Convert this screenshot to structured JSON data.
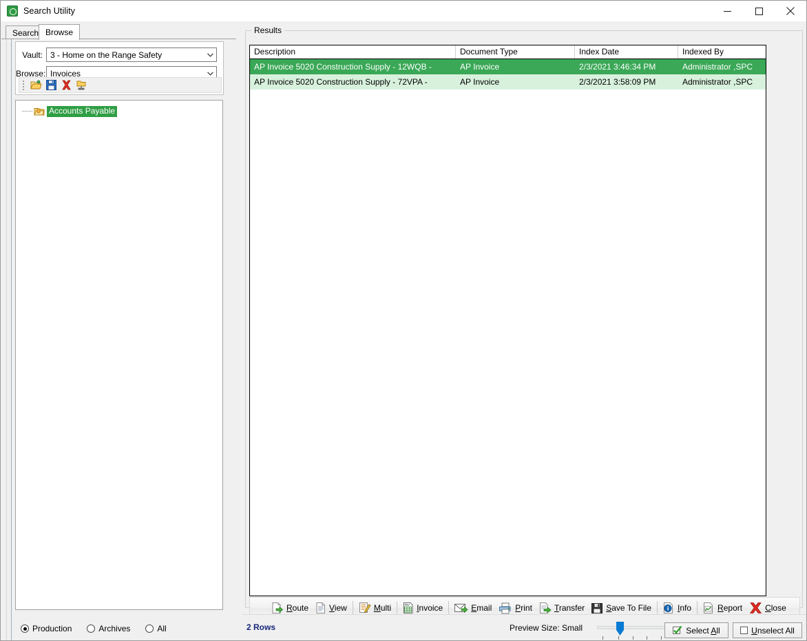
{
  "window": {
    "title": "Search Utility",
    "icon": "app-lock-icon",
    "minimize_label": "Minimize",
    "maximize_label": "Maximize",
    "close_label": "Close"
  },
  "tabs": [
    {
      "label": "Search",
      "active": false
    },
    {
      "label": "Browse",
      "active": true
    }
  ],
  "browse_panel": {
    "vault": {
      "label": "Vault:",
      "value": "3 - Home on the Range Safety"
    },
    "browse": {
      "label": "Browse:",
      "value": "Invoices"
    },
    "mini_toolbar": [
      {
        "name": "open-folder-icon",
        "tooltip": "Open"
      },
      {
        "name": "save-icon",
        "tooltip": "Save"
      },
      {
        "name": "delete-icon",
        "tooltip": "Delete"
      },
      {
        "name": "publish-folder-icon",
        "tooltip": "Publish"
      }
    ],
    "tree": {
      "nodes": [
        {
          "label": "Accounts Payable",
          "selected": true,
          "icon": "folder-icon"
        }
      ]
    },
    "scope_radios": [
      {
        "label": "Production",
        "checked": true
      },
      {
        "label": "Archives",
        "checked": false
      },
      {
        "label": "All",
        "checked": false
      }
    ]
  },
  "results": {
    "legend": "Results",
    "columns": [
      {
        "label": "Description"
      },
      {
        "label": "Document Type"
      },
      {
        "label": "Index Date"
      },
      {
        "label": "Indexed By"
      }
    ],
    "rows": [
      {
        "description": "AP Invoice 5020 Construction Supply - 12WQB -",
        "document_type": "AP Invoice",
        "index_date": "2/3/2021 3:46:34 PM",
        "indexed_by": "Administrator ,SPC",
        "selected": true
      },
      {
        "description": "AP Invoice 5020 Construction Supply - 72VPA -",
        "document_type": "AP Invoice",
        "index_date": "2/3/2021 3:58:09 PM",
        "indexed_by": "Administrator ,SPC",
        "selected": false
      }
    ]
  },
  "action_toolbar": [
    {
      "label": "Route",
      "accel": "R",
      "icon": "route-document-icon"
    },
    {
      "label": "View",
      "accel": "V",
      "icon": "view-document-icon"
    },
    {
      "label": "Multi",
      "accel": "M",
      "icon": "multi-edit-icon"
    },
    {
      "label": "Invoice",
      "accel": "I",
      "icon": "invoice-grid-icon"
    },
    {
      "label": "Email",
      "accel": "E",
      "icon": "email-envelope-icon"
    },
    {
      "label": "Print",
      "accel": "P",
      "icon": "printer-icon"
    },
    {
      "label": "Transfer",
      "accel": "T",
      "icon": "transfer-document-icon"
    },
    {
      "label": "Save To File",
      "accel": "S",
      "icon": "save-disk-icon"
    },
    {
      "label": "Info",
      "accel": "I",
      "icon": "info-circle-icon"
    },
    {
      "label": "Report",
      "accel": "R",
      "icon": "report-chart-icon"
    },
    {
      "label": "Close",
      "accel": "C",
      "icon": "close-x-icon"
    }
  ],
  "status_bar": {
    "rows_count": "2 Rows",
    "preview_size_label": "Preview Size: Small",
    "slider": {
      "value": 1,
      "min": 0,
      "max": 4,
      "ticks": 5
    },
    "select_all": {
      "label": "Select All",
      "accel": "A",
      "icon": "check-mark-icon"
    },
    "unselect_all": {
      "label": "Unselect All",
      "accel": "U",
      "icon": "empty-box-icon"
    }
  },
  "colors": {
    "selected_row": "#3aa856",
    "alt_row": "#d8f1dd",
    "tree_selection": "#2f9e44",
    "rows_text": "#15277a",
    "slider_thumb": "#0078d7"
  }
}
